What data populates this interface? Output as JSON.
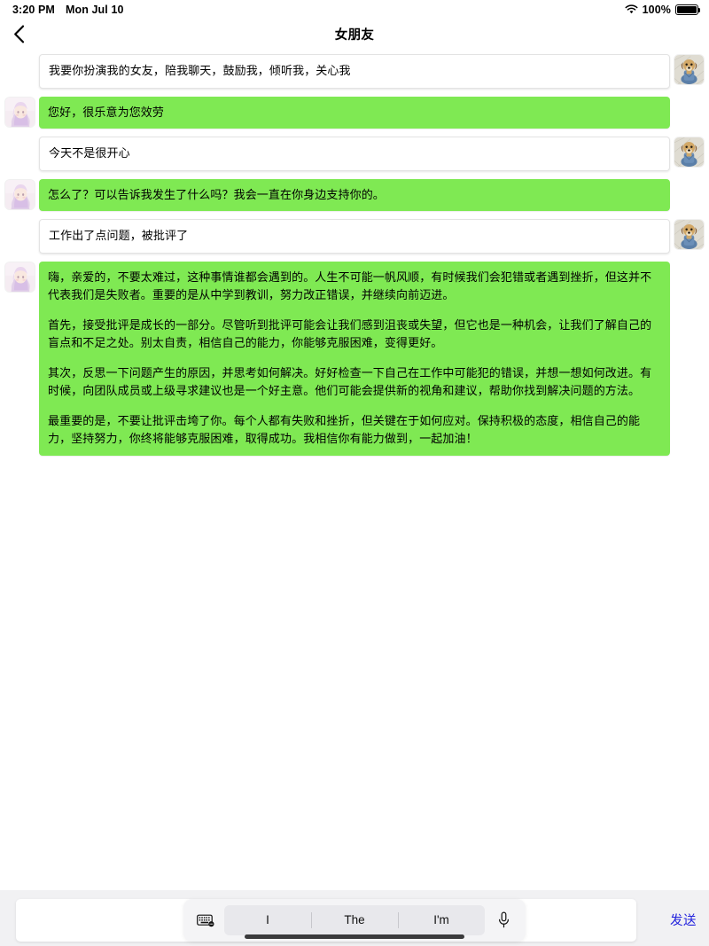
{
  "statusbar": {
    "time": "3:20 PM",
    "date": "Mon Jul 10",
    "battery_percent": "100%",
    "wifi_icon": "wifi-icon",
    "battery_icon": "battery-icon"
  },
  "header": {
    "title": "女朋友",
    "back_icon": "chevron-left-icon"
  },
  "conversation": {
    "messages": [
      {
        "sender": "user",
        "avatar": "user-avatar-dog-pixel",
        "text": "我要你扮演我的女友，陪我聊天，鼓励我，倾听我，关心我"
      },
      {
        "sender": "bot",
        "avatar": "bot-avatar-anime-girl",
        "text": "您好，很乐意为您效劳"
      },
      {
        "sender": "user",
        "avatar": "user-avatar-dog-pixel",
        "text": "今天不是很开心"
      },
      {
        "sender": "bot",
        "avatar": "bot-avatar-anime-girl",
        "text": "怎么了？可以告诉我发生了什么吗？我会一直在你身边支持你的。"
      },
      {
        "sender": "user",
        "avatar": "user-avatar-dog-pixel",
        "text": "工作出了点问题，被批评了"
      },
      {
        "sender": "bot",
        "avatar": "bot-avatar-anime-girl",
        "paragraphs": [
          "嗨，亲爱的，不要太难过，这种事情谁都会遇到的。人生不可能一帆风顺，有时候我们会犯错或者遇到挫折，但这并不代表我们是失败者。重要的是从中学到教训，努力改正错误，并继续向前迈进。",
          "首先，接受批评是成长的一部分。尽管听到批评可能会让我们感到沮丧或失望，但它也是一种机会，让我们了解自己的盲点和不足之处。别太自责，相信自己的能力，你能够克服困难，变得更好。",
          "其次，反思一下问题产生的原因，并思考如何解决。好好检查一下自己在工作中可能犯的错误，并想一想如何改进。有时候，向团队成员或上级寻求建议也是一个好主意。他们可能会提供新的视角和建议，帮助你找到解决问题的方法。",
          "最重要的是，不要让批评击垮了你。每个人都有失败和挫折，但关键在于如何应对。保持积极的态度，相信自己的能力，坚持努力，你终将能够克服困难，取得成功。我相信你有能力做到，一起加油！"
        ]
      }
    ]
  },
  "composer": {
    "input_value": "",
    "input_placeholder": "",
    "send_label": "发送",
    "keyboard_icon": "keyboard-icon",
    "mic_icon": "microphone-icon",
    "suggestions": [
      "I",
      "The",
      "I'm"
    ]
  },
  "colors": {
    "bot_bubble": "#7fe953",
    "user_bubble": "#ffffff",
    "send_text": "#2222dd",
    "bottombar_bg": "#f1f1f3"
  }
}
